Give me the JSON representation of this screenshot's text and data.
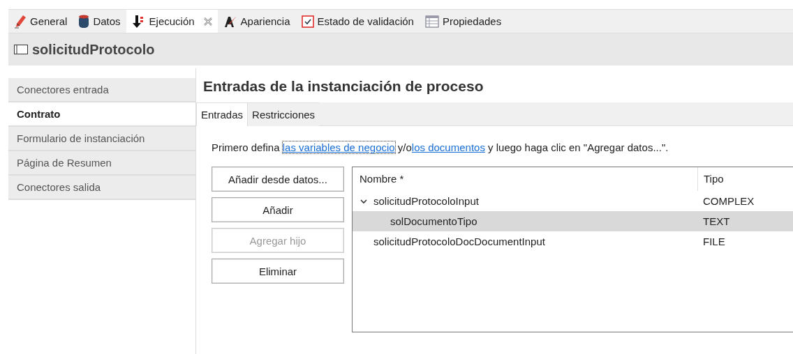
{
  "editor_tabs": [
    {
      "label": "General",
      "kind": "pencil",
      "selected": false,
      "closable": false
    },
    {
      "label": "Datos",
      "kind": "database",
      "selected": false,
      "closable": false
    },
    {
      "label": "Ejecución",
      "kind": "flow",
      "selected": true,
      "closable": true
    },
    {
      "label": "Apariencia",
      "kind": "brush",
      "selected": false,
      "closable": false
    },
    {
      "label": "Estado de validación",
      "kind": "checkbox",
      "selected": false,
      "closable": false
    },
    {
      "label": "Propiedades",
      "kind": "table",
      "selected": false,
      "closable": false
    }
  ],
  "header": {
    "title": "solicitudProtocolo"
  },
  "sidebar": {
    "items": [
      {
        "label": "Conectores entrada",
        "selected": false
      },
      {
        "label": "Contrato",
        "selected": true
      },
      {
        "label": "Formulario de instanciación",
        "selected": false
      },
      {
        "label": "Página de Resumen",
        "selected": false
      },
      {
        "label": "Conectores salida",
        "selected": false
      }
    ]
  },
  "section_title": "Entradas de la instanciación de proceso",
  "tabs": [
    {
      "label": "Entradas",
      "selected": true
    },
    {
      "label": "Restricciones",
      "selected": false
    }
  ],
  "message": {
    "before": "Primero defina ",
    "link1": "las variables de negocio",
    "middle": " y/o",
    "link2": "los documentos",
    "after": " y luego haga clic en \"Agregar datos...\"."
  },
  "buttons": [
    {
      "label": "Añadir desde datos...",
      "disabled": false
    },
    {
      "label": "Añadir",
      "disabled": false
    },
    {
      "label": "Agregar hijo",
      "disabled": true
    },
    {
      "label": "Eliminar",
      "disabled": false
    }
  ],
  "table": {
    "columns": [
      "Nombre *",
      "Tipo"
    ],
    "rows": [
      {
        "name": "solicitudProtocoloInput",
        "type": "COMPLEX",
        "selected": false,
        "expanded": true,
        "children": [
          {
            "name": "solDocumentoTipo",
            "type": "TEXT",
            "selected": true
          }
        ]
      },
      {
        "name": "solicitudProtocoloDocDocumentInput",
        "type": "FILE",
        "selected": false
      }
    ]
  }
}
